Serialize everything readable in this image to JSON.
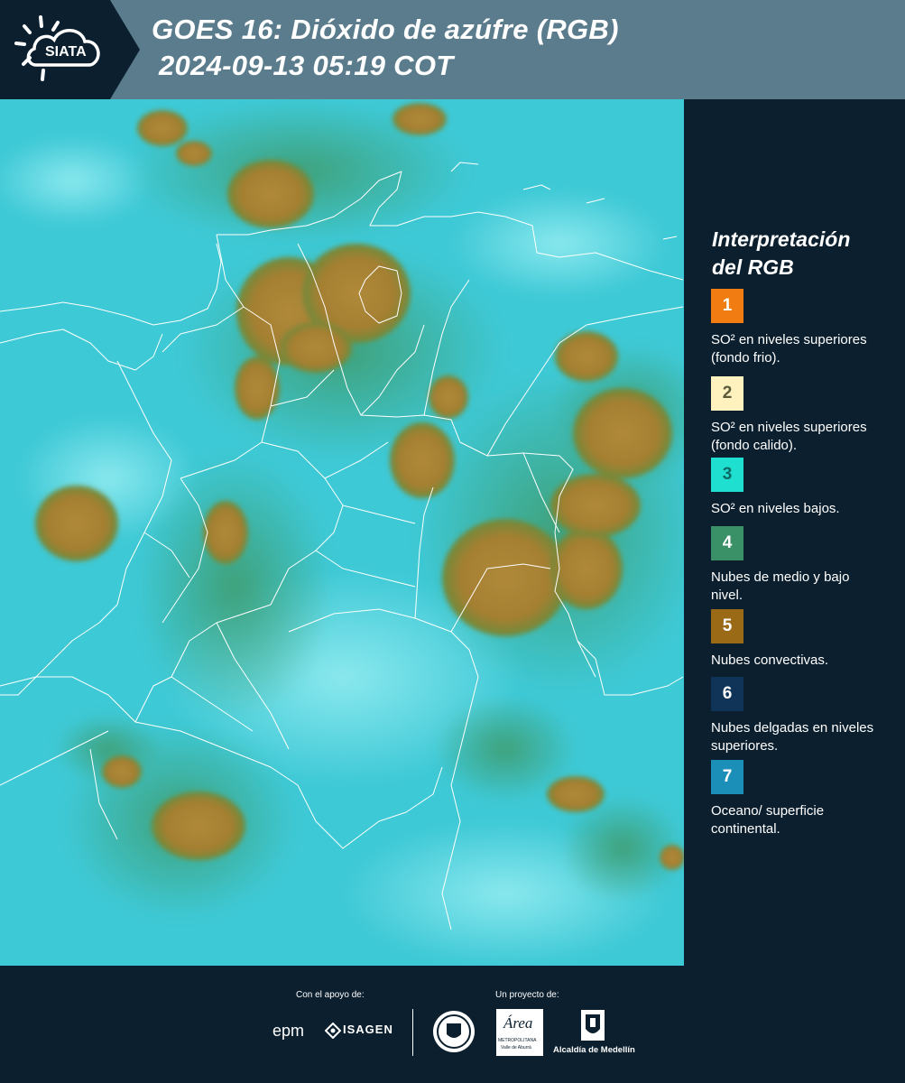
{
  "header": {
    "logo_text": "SIATA",
    "title_line1": "GOES 16: Dióxido de azúfre (RGB)",
    "title_line2": "2024-09-13 05:19 COT"
  },
  "legend": {
    "title_line1": "Interpretación",
    "title_line2": "del RGB",
    "items": [
      {
        "number": "1",
        "color": "#f07c12",
        "number_color": "#ffffff",
        "text": "SO² en niveles superiores (fondo frio)."
      },
      {
        "number": "2",
        "color": "#fff2bf",
        "number_color": "#5b5b3a",
        "text": "SO² en niveles superiores (fondo calido)."
      },
      {
        "number": "3",
        "color": "#1fe0d0",
        "number_color": "#0e6a66",
        "text": "SO² en niveles bajos."
      },
      {
        "number": "4",
        "color": "#3a9168",
        "number_color": "#ffffff",
        "text": "Nubes de medio y bajo nivel."
      },
      {
        "number": "5",
        "color": "#9a6a16",
        "number_color": "#ffffff",
        "text": "Nubes convectivas."
      },
      {
        "number": "6",
        "color": "#0f3458",
        "number_color": "#ffffff",
        "text": "Nubes delgadas en niveles superiores."
      },
      {
        "number": "7",
        "color": "#1c8fb8",
        "number_color": "#ffffff",
        "text": "Oceano/ superficie continental."
      }
    ]
  },
  "footer": {
    "support_label": "Con el apoyo de:",
    "project_label": "Un proyecto de:",
    "sponsors": [
      "epm",
      "ISAGEN"
    ],
    "partners": [
      "Área",
      "METROPOLITANA",
      "Valle de Aburrá",
      "Alcaldía de Medellín"
    ]
  }
}
